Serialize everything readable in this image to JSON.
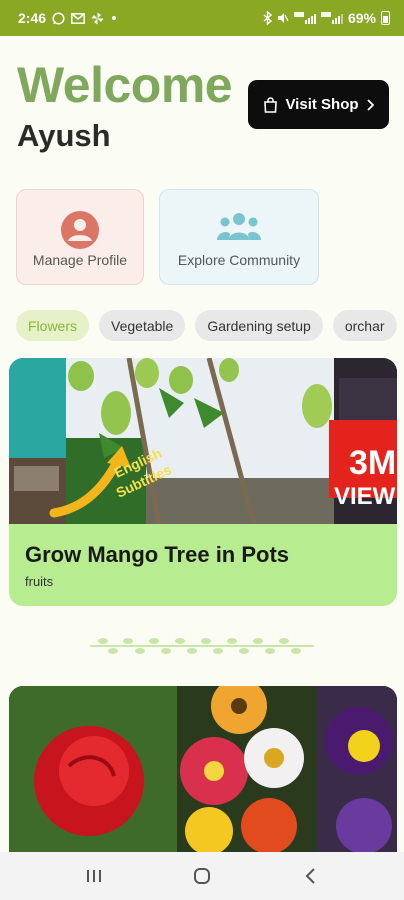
{
  "status_bar": {
    "time": "2:46",
    "left_icons": [
      "whatsapp-icon",
      "gmail-icon",
      "pinwheel-icon",
      "dot-icon"
    ],
    "right_icons": [
      "bluetooth-icon",
      "mute-icon",
      "volte-signal-icon",
      "lte-signal-icon"
    ],
    "battery": "69%"
  },
  "header": {
    "welcome": "Welcome",
    "username": "Ayush",
    "shop_button": "Visit Shop"
  },
  "actions": {
    "profile_label": "Manage Profile",
    "community_label": "Explore Community"
  },
  "categories": [
    "Flowers",
    "Vegetable",
    "Gardening setup",
    "orchar"
  ],
  "active_category": "Flowers",
  "post": {
    "title": "Grow Mango Tree in Pots",
    "tag": "fruits",
    "thumb_text_1": "English",
    "thumb_text_2": "Subtitles",
    "badge_num": "3M",
    "badge_text": "VIEW"
  },
  "colors": {
    "status_bar": "#8aa824",
    "welcome": "#7fa85d",
    "card": "#b8ec91",
    "chip_active": "#e6f0c9"
  }
}
